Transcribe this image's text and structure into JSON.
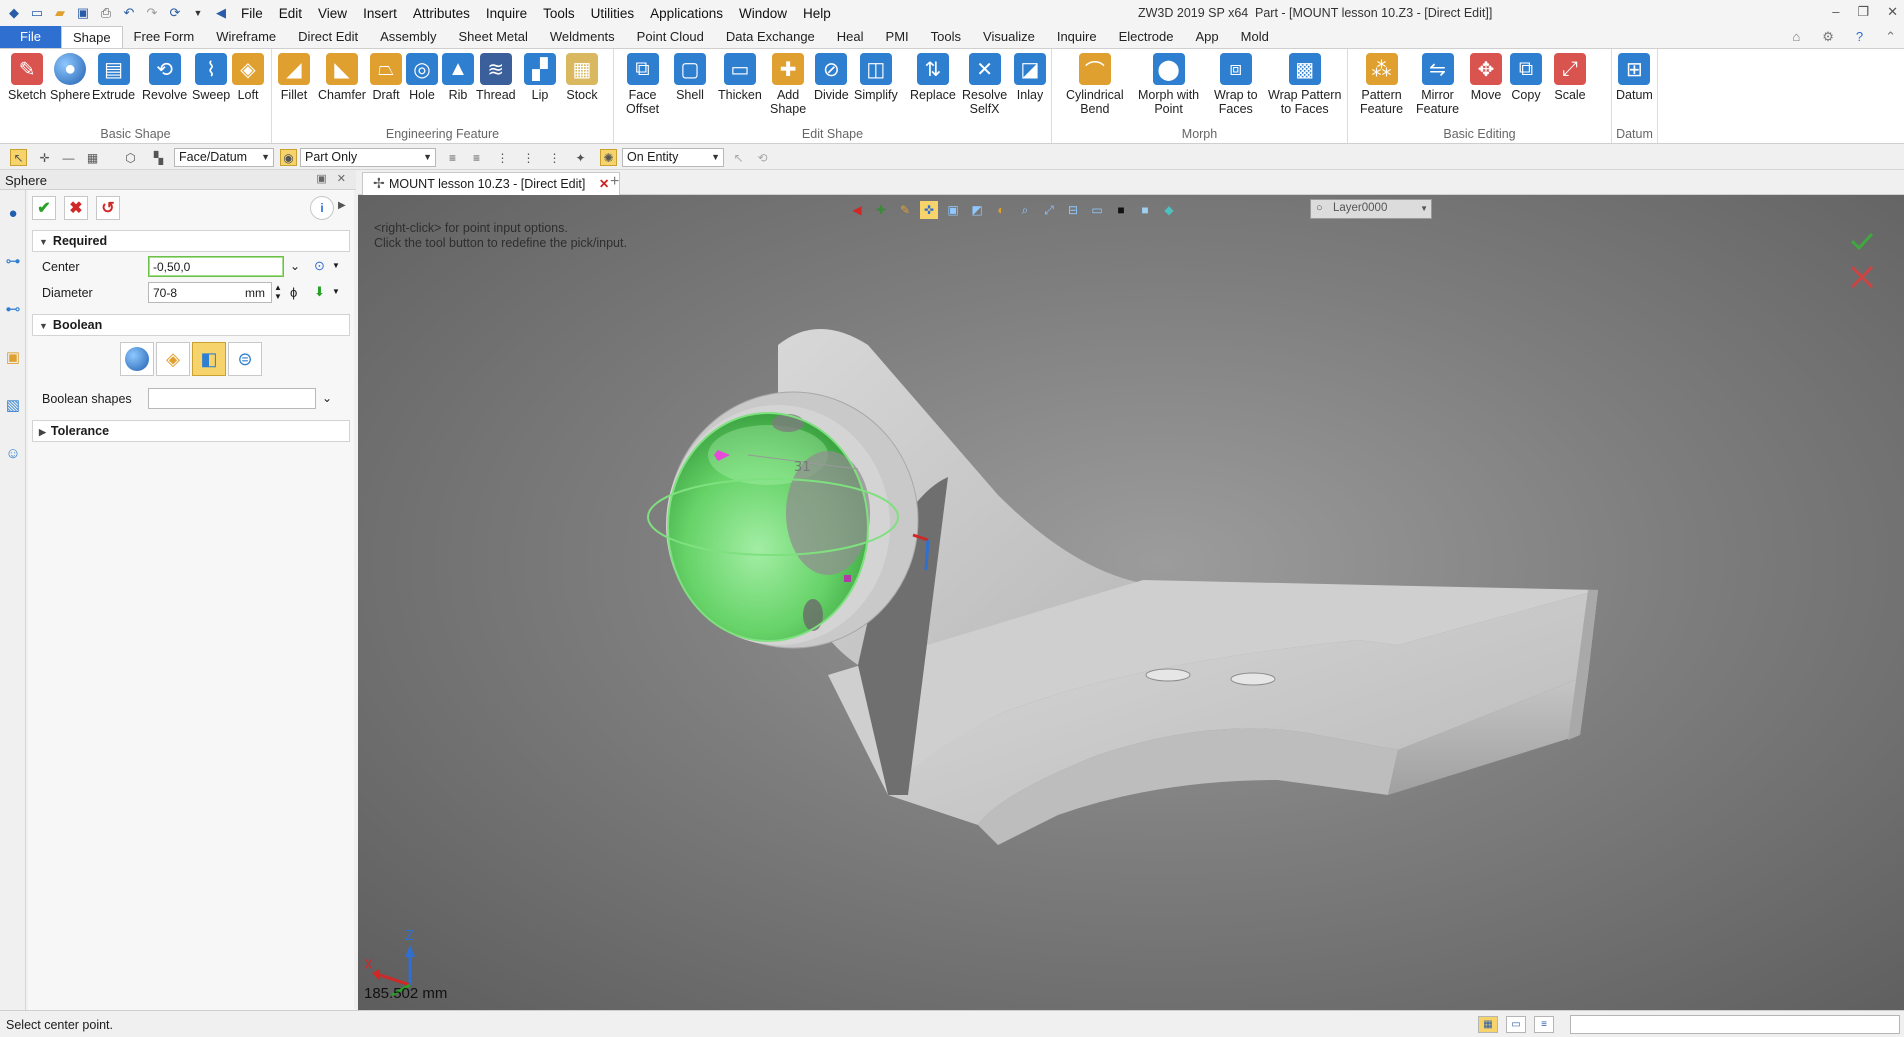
{
  "titlebar": {
    "menus": [
      "File",
      "Edit",
      "View",
      "Insert",
      "Attributes",
      "Inquire",
      "Tools",
      "Utilities",
      "Applications",
      "Window",
      "Help"
    ],
    "app_title": "ZW3D 2019 SP x64",
    "doc_title": "Part - [MOUNT lesson 10.Z3 - [Direct Edit]]"
  },
  "ribbon_tabs": [
    "File",
    "Shape",
    "Free Form",
    "Wireframe",
    "Direct Edit",
    "Assembly",
    "Sheet Metal",
    "Weldments",
    "Point Cloud",
    "Data Exchange",
    "Heal",
    "PMI",
    "Tools",
    "Visualize",
    "Inquire",
    "Electrode",
    "App",
    "Mold"
  ],
  "ribbon_active": "Shape",
  "ribbon_groups": {
    "basic_shape": {
      "label": "Basic Shape",
      "buttons": [
        {
          "label": "Sketch",
          "icon": "sketch-icon",
          "color": "#d9534f"
        },
        {
          "label": "Sphere",
          "icon": "sphere-icon",
          "color": "#2f7fd0"
        },
        {
          "label": "Extrude",
          "icon": "extrude-icon",
          "color": "#2f7fd0"
        },
        {
          "label": "Revolve",
          "icon": "revolve-icon",
          "color": "#2f7fd0"
        },
        {
          "label": "Sweep",
          "icon": "sweep-icon",
          "color": "#2f7fd0"
        },
        {
          "label": "Loft",
          "icon": "loft-icon",
          "color": "#e0a030"
        }
      ]
    },
    "engineering_feature": {
      "label": "Engineering Feature",
      "buttons": [
        {
          "label": "Fillet",
          "icon": "fillet-icon",
          "color": "#e0a030"
        },
        {
          "label": "Chamfer",
          "icon": "chamfer-icon",
          "color": "#e0a030"
        },
        {
          "label": "Draft",
          "icon": "draft-icon",
          "color": "#e0a030"
        },
        {
          "label": "Hole",
          "icon": "hole-icon",
          "color": "#2f7fd0"
        },
        {
          "label": "Rib",
          "icon": "rib-icon",
          "color": "#2f7fd0"
        },
        {
          "label": "Thread",
          "icon": "thread-icon",
          "color": "#3a5f9a"
        },
        {
          "label": "Lip",
          "icon": "lip-icon",
          "color": "#2f7fd0"
        },
        {
          "label": "Stock",
          "icon": "stock-icon",
          "color": "#d9b860"
        }
      ]
    },
    "edit_shape": {
      "label": "Edit Shape",
      "buttons": [
        {
          "label": "Face\nOffset",
          "icon": "face-offset-icon",
          "color": "#2f7fd0"
        },
        {
          "label": "Shell",
          "icon": "shell-icon",
          "color": "#2f7fd0"
        },
        {
          "label": "Thicken",
          "icon": "thicken-icon",
          "color": "#2f7fd0"
        },
        {
          "label": "Add\nShape",
          "icon": "add-shape-icon",
          "color": "#e0a030"
        },
        {
          "label": "Divide",
          "icon": "divide-icon",
          "color": "#2f7fd0"
        },
        {
          "label": "Simplify",
          "icon": "simplify-icon",
          "color": "#2f7fd0"
        },
        {
          "label": "Replace",
          "icon": "replace-icon",
          "color": "#2f7fd0"
        },
        {
          "label": "Resolve\nSelfX",
          "icon": "resolve-selfx-icon",
          "color": "#2f7fd0"
        },
        {
          "label": "Inlay",
          "icon": "inlay-icon",
          "color": "#2f7fd0"
        }
      ]
    },
    "morph": {
      "label": "Morph",
      "buttons": [
        {
          "label": "Cylindrical\nBend",
          "icon": "cylindrical-bend-icon",
          "color": "#e0a030"
        },
        {
          "label": "Morph with\nPoint",
          "icon": "morph-point-icon",
          "color": "#2f7fd0"
        },
        {
          "label": "Wrap to\nFaces",
          "icon": "wrap-faces-icon",
          "color": "#2f7fd0"
        },
        {
          "label": "Wrap Pattern\nto Faces",
          "icon": "wrap-pattern-icon",
          "color": "#2f7fd0"
        }
      ]
    },
    "basic_editing": {
      "label": "Basic Editing",
      "buttons": [
        {
          "label": "Pattern\nFeature",
          "icon": "pattern-feature-icon",
          "color": "#e0a030"
        },
        {
          "label": "Mirror\nFeature",
          "icon": "mirror-feature-icon",
          "color": "#2f7fd0"
        },
        {
          "label": "Move",
          "icon": "move-icon",
          "color": "#d9534f"
        },
        {
          "label": "Copy",
          "icon": "copy-icon",
          "color": "#2f7fd0"
        },
        {
          "label": "Scale",
          "icon": "scale-icon",
          "color": "#d9534f"
        }
      ]
    },
    "datum": {
      "label": "Datum",
      "buttons": [
        {
          "label": "Datum",
          "icon": "datum-icon",
          "color": "#2f7fd0"
        }
      ]
    }
  },
  "toolbar2": {
    "filter": "Face/Datum",
    "scope": "Part Only",
    "pick_mode": "On Entity"
  },
  "panel": {
    "title": "Sphere",
    "required_label": "Required",
    "center_label": "Center",
    "center_value": "-0,50,0",
    "diameter_label": "Diameter",
    "diameter_value": "70-8",
    "diameter_unit": "mm",
    "boolean_label": "Boolean",
    "boolean_shapes_label": "Boolean shapes",
    "boolean_shapes_value": "",
    "tolerance_label": "Tolerance"
  },
  "doc_tab": {
    "label": "MOUNT lesson 10.Z3 - [Direct Edit]"
  },
  "viewport": {
    "hint_line1": "<right-click> for point input options.",
    "hint_line2": "Click the tool button to redefine the pick/input.",
    "layer": "Layer0000",
    "scale": "185.502 mm",
    "axis_x": "X",
    "axis_z": "Z",
    "dimension": "31"
  },
  "status": {
    "message": "Select center point."
  },
  "colors": {
    "accent": "#2f6fd0",
    "preview_green": "#5bd35b",
    "ok_green": "#27a127",
    "cancel_red": "#d02727",
    "selected_yellow": "#f6d36b"
  }
}
